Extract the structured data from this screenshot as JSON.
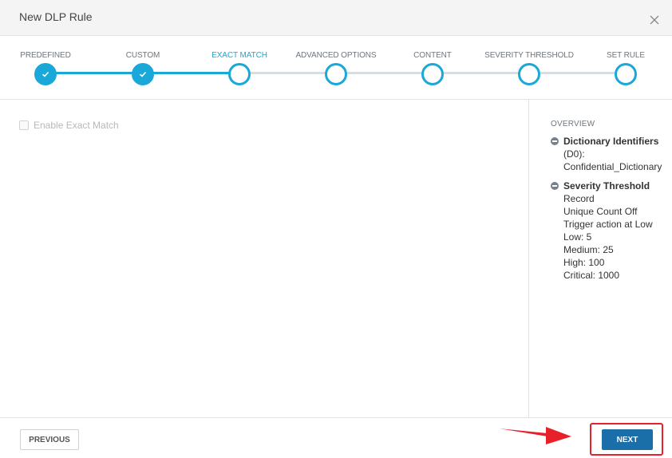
{
  "dialog": {
    "title": "New DLP Rule"
  },
  "steps": [
    {
      "label": "PREDEFINED",
      "state": "done"
    },
    {
      "label": "CUSTOM",
      "state": "done"
    },
    {
      "label": "EXACT MATCH",
      "state": "active"
    },
    {
      "label": "ADVANCED OPTIONS",
      "state": "pending"
    },
    {
      "label": "CONTENT",
      "state": "pending"
    },
    {
      "label": "SEVERITY THRESHOLD",
      "state": "pending"
    },
    {
      "label": "SET RULE",
      "state": "pending"
    }
  ],
  "main": {
    "enable_exact_match_label": "Enable Exact Match",
    "enable_exact_match_checked": false
  },
  "overview": {
    "title": "OVERVIEW",
    "sections": [
      {
        "heading": "Dictionary Identifiers",
        "lines": [
          "(D0):",
          "Confidential_Dictionary"
        ]
      },
      {
        "heading": "Severity Threshold",
        "lines": [
          "Record",
          "Unique Count Off",
          "Trigger action at Low",
          "Low: 5",
          "Medium: 25",
          "High: 100",
          "Critical: 1000"
        ]
      }
    ]
  },
  "footer": {
    "previous_label": "PREVIOUS",
    "next_label": "NEXT"
  },
  "colors": {
    "accent": "#1aa8d8",
    "primary_button": "#1a6fa8",
    "highlight": "#e8202a"
  }
}
